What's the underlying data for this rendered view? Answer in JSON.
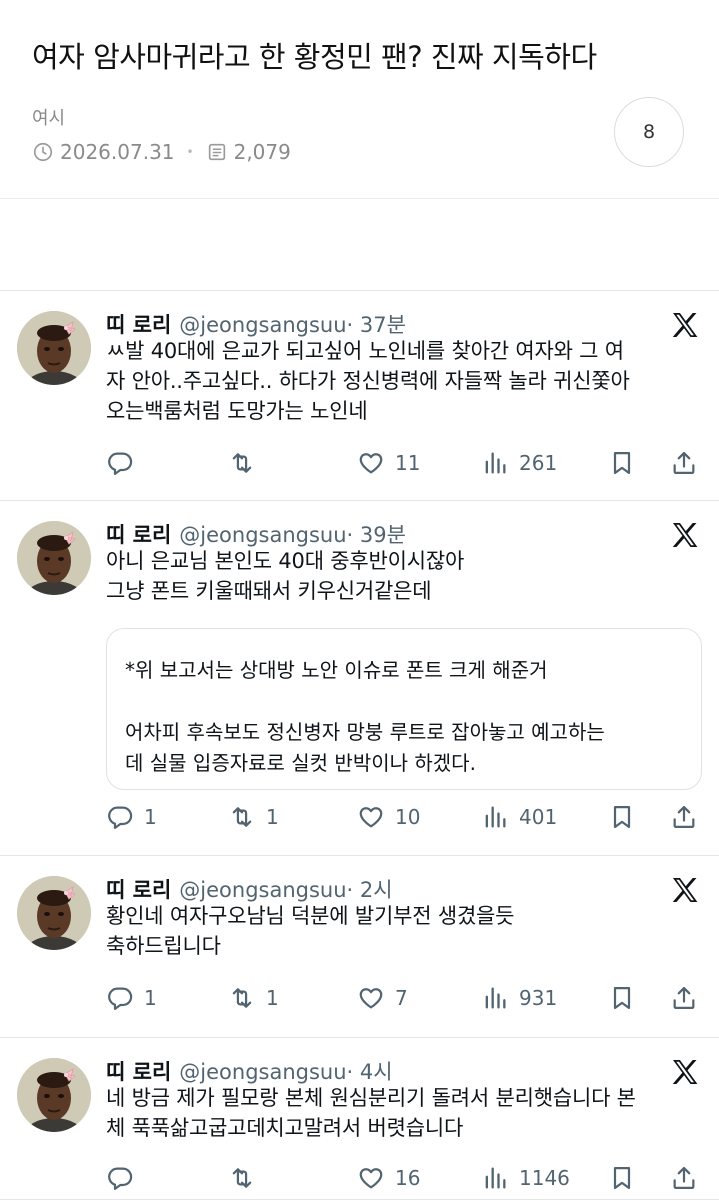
{
  "post": {
    "title": "여자 암사마귀라고 한 황정민 팬? 진짜 지독하다",
    "board": "여시",
    "date": "2026.07.31",
    "views": "2,079",
    "comment_count": "8"
  },
  "tweets": [
    {
      "name": "띠 로리",
      "handle": "@jeongsangsuu",
      "time": "· 37분",
      "lines": [
        "ㅆ발 40대에 은교가 되고싶어 노인네를 찾아간 여자와 그 여",
        "자 안아..주고싶다.. 하다가 정신병력에 자들짝 놀라 귀신쫓아",
        "오는백룸처럼 도망가는 노인네"
      ],
      "replies": "",
      "retweets": "",
      "likes": "11",
      "views": "261"
    },
    {
      "name": "띠 로리",
      "handle": "@jeongsangsuu",
      "time": "· 39분",
      "lines": [
        "아니 은교님 본인도 40대 중후반이시잖아",
        "그냥 폰트 키울때돼서 키우신거같은데"
      ],
      "quote": [
        "*위 보고서는 상대방 노안 이슈로 폰트 크게 해준거",
        "",
        "어차피 후속보도 정신병자 망붕 루트로 잡아놓고 예고하는",
        "데 실물 입증자료로 실컷 반박이나 하겠다."
      ],
      "replies": "1",
      "retweets": "1",
      "likes": "10",
      "views": "401"
    },
    {
      "name": "띠 로리",
      "handle": "@jeongsangsuu",
      "time": "· 2시",
      "lines": [
        "황인네 여자구오남님 덕분에 발기부전 생겼을듯",
        "축하드립니다"
      ],
      "replies": "1",
      "retweets": "1",
      "likes": "7",
      "views": "931"
    },
    {
      "name": "띠 로리",
      "handle": "@jeongsangsuu",
      "time": "· 4시",
      "lines": [
        "네 방금 제가 필모랑 본체 원심분리기 돌려서 분리햇습니다 본",
        "체 푹푹삶고굽고데치고말려서 버렷습니다"
      ],
      "replies": "",
      "retweets": "",
      "likes": "16",
      "views": "1146"
    }
  ],
  "icons": {
    "reply": "reply-icon",
    "retweet": "retweet-icon",
    "like": "heart-icon",
    "views": "views-bar-icon",
    "bookmark": "bookmark-icon",
    "share": "share-icon",
    "platform": "x-logo-icon"
  },
  "colors": {
    "text": "#0f1419",
    "secondary": "#536471",
    "meta_gray": "#8a8a8a"
  }
}
